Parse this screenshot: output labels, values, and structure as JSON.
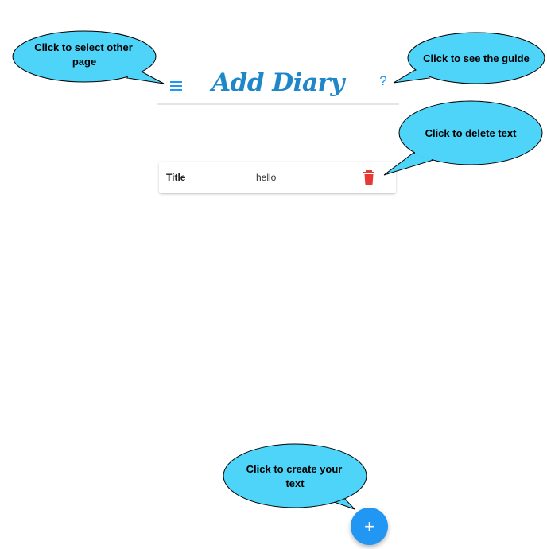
{
  "app": {
    "title": "Add Diary",
    "help_symbol": "?",
    "menu_icon": "menu-icon",
    "accent_color": "#2196f3",
    "title_color": "#1f87c8",
    "delete_color": "#e53935"
  },
  "entry": {
    "label": "Title",
    "value": "hello",
    "delete_icon": "trash-icon"
  },
  "fab": {
    "symbol": "+",
    "icon": "plus-icon"
  },
  "callouts": {
    "menu": {
      "line1": "Click to select other",
      "line2": "page"
    },
    "guide": {
      "line1": "Click to see the guide"
    },
    "delete": {
      "line1": "Click to delete text"
    },
    "create": {
      "line1": "Click to create your",
      "line2": "text"
    },
    "bubble_color": "#4dd4f8"
  }
}
